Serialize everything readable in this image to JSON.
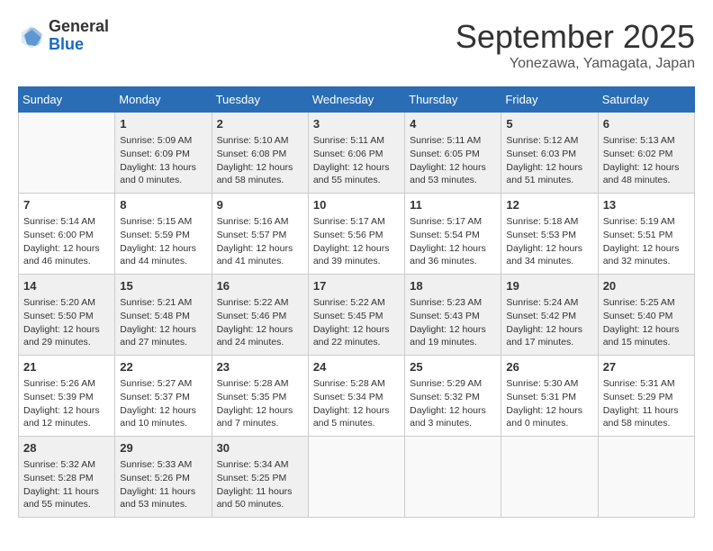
{
  "logo": {
    "general": "General",
    "blue": "Blue"
  },
  "title": "September 2025",
  "location": "Yonezawa, Yamagata, Japan",
  "days_of_week": [
    "Sunday",
    "Monday",
    "Tuesday",
    "Wednesday",
    "Thursday",
    "Friday",
    "Saturday"
  ],
  "weeks": [
    [
      {
        "day": "",
        "info": []
      },
      {
        "day": "1",
        "info": [
          "Sunrise: 5:09 AM",
          "Sunset: 6:09 PM",
          "Daylight: 13 hours",
          "and 0 minutes."
        ]
      },
      {
        "day": "2",
        "info": [
          "Sunrise: 5:10 AM",
          "Sunset: 6:08 PM",
          "Daylight: 12 hours",
          "and 58 minutes."
        ]
      },
      {
        "day": "3",
        "info": [
          "Sunrise: 5:11 AM",
          "Sunset: 6:06 PM",
          "Daylight: 12 hours",
          "and 55 minutes."
        ]
      },
      {
        "day": "4",
        "info": [
          "Sunrise: 5:11 AM",
          "Sunset: 6:05 PM",
          "Daylight: 12 hours",
          "and 53 minutes."
        ]
      },
      {
        "day": "5",
        "info": [
          "Sunrise: 5:12 AM",
          "Sunset: 6:03 PM",
          "Daylight: 12 hours",
          "and 51 minutes."
        ]
      },
      {
        "day": "6",
        "info": [
          "Sunrise: 5:13 AM",
          "Sunset: 6:02 PM",
          "Daylight: 12 hours",
          "and 48 minutes."
        ]
      }
    ],
    [
      {
        "day": "7",
        "info": [
          "Sunrise: 5:14 AM",
          "Sunset: 6:00 PM",
          "Daylight: 12 hours",
          "and 46 minutes."
        ]
      },
      {
        "day": "8",
        "info": [
          "Sunrise: 5:15 AM",
          "Sunset: 5:59 PM",
          "Daylight: 12 hours",
          "and 44 minutes."
        ]
      },
      {
        "day": "9",
        "info": [
          "Sunrise: 5:16 AM",
          "Sunset: 5:57 PM",
          "Daylight: 12 hours",
          "and 41 minutes."
        ]
      },
      {
        "day": "10",
        "info": [
          "Sunrise: 5:17 AM",
          "Sunset: 5:56 PM",
          "Daylight: 12 hours",
          "and 39 minutes."
        ]
      },
      {
        "day": "11",
        "info": [
          "Sunrise: 5:17 AM",
          "Sunset: 5:54 PM",
          "Daylight: 12 hours",
          "and 36 minutes."
        ]
      },
      {
        "day": "12",
        "info": [
          "Sunrise: 5:18 AM",
          "Sunset: 5:53 PM",
          "Daylight: 12 hours",
          "and 34 minutes."
        ]
      },
      {
        "day": "13",
        "info": [
          "Sunrise: 5:19 AM",
          "Sunset: 5:51 PM",
          "Daylight: 12 hours",
          "and 32 minutes."
        ]
      }
    ],
    [
      {
        "day": "14",
        "info": [
          "Sunrise: 5:20 AM",
          "Sunset: 5:50 PM",
          "Daylight: 12 hours",
          "and 29 minutes."
        ]
      },
      {
        "day": "15",
        "info": [
          "Sunrise: 5:21 AM",
          "Sunset: 5:48 PM",
          "Daylight: 12 hours",
          "and 27 minutes."
        ]
      },
      {
        "day": "16",
        "info": [
          "Sunrise: 5:22 AM",
          "Sunset: 5:46 PM",
          "Daylight: 12 hours",
          "and 24 minutes."
        ]
      },
      {
        "day": "17",
        "info": [
          "Sunrise: 5:22 AM",
          "Sunset: 5:45 PM",
          "Daylight: 12 hours",
          "and 22 minutes."
        ]
      },
      {
        "day": "18",
        "info": [
          "Sunrise: 5:23 AM",
          "Sunset: 5:43 PM",
          "Daylight: 12 hours",
          "and 19 minutes."
        ]
      },
      {
        "day": "19",
        "info": [
          "Sunrise: 5:24 AM",
          "Sunset: 5:42 PM",
          "Daylight: 12 hours",
          "and 17 minutes."
        ]
      },
      {
        "day": "20",
        "info": [
          "Sunrise: 5:25 AM",
          "Sunset: 5:40 PM",
          "Daylight: 12 hours",
          "and 15 minutes."
        ]
      }
    ],
    [
      {
        "day": "21",
        "info": [
          "Sunrise: 5:26 AM",
          "Sunset: 5:39 PM",
          "Daylight: 12 hours",
          "and 12 minutes."
        ]
      },
      {
        "day": "22",
        "info": [
          "Sunrise: 5:27 AM",
          "Sunset: 5:37 PM",
          "Daylight: 12 hours",
          "and 10 minutes."
        ]
      },
      {
        "day": "23",
        "info": [
          "Sunrise: 5:28 AM",
          "Sunset: 5:35 PM",
          "Daylight: 12 hours",
          "and 7 minutes."
        ]
      },
      {
        "day": "24",
        "info": [
          "Sunrise: 5:28 AM",
          "Sunset: 5:34 PM",
          "Daylight: 12 hours",
          "and 5 minutes."
        ]
      },
      {
        "day": "25",
        "info": [
          "Sunrise: 5:29 AM",
          "Sunset: 5:32 PM",
          "Daylight: 12 hours",
          "and 3 minutes."
        ]
      },
      {
        "day": "26",
        "info": [
          "Sunrise: 5:30 AM",
          "Sunset: 5:31 PM",
          "Daylight: 12 hours",
          "and 0 minutes."
        ]
      },
      {
        "day": "27",
        "info": [
          "Sunrise: 5:31 AM",
          "Sunset: 5:29 PM",
          "Daylight: 11 hours",
          "and 58 minutes."
        ]
      }
    ],
    [
      {
        "day": "28",
        "info": [
          "Sunrise: 5:32 AM",
          "Sunset: 5:28 PM",
          "Daylight: 11 hours",
          "and 55 minutes."
        ]
      },
      {
        "day": "29",
        "info": [
          "Sunrise: 5:33 AM",
          "Sunset: 5:26 PM",
          "Daylight: 11 hours",
          "and 53 minutes."
        ]
      },
      {
        "day": "30",
        "info": [
          "Sunrise: 5:34 AM",
          "Sunset: 5:25 PM",
          "Daylight: 11 hours",
          "and 50 minutes."
        ]
      },
      {
        "day": "",
        "info": []
      },
      {
        "day": "",
        "info": []
      },
      {
        "day": "",
        "info": []
      },
      {
        "day": "",
        "info": []
      }
    ]
  ]
}
